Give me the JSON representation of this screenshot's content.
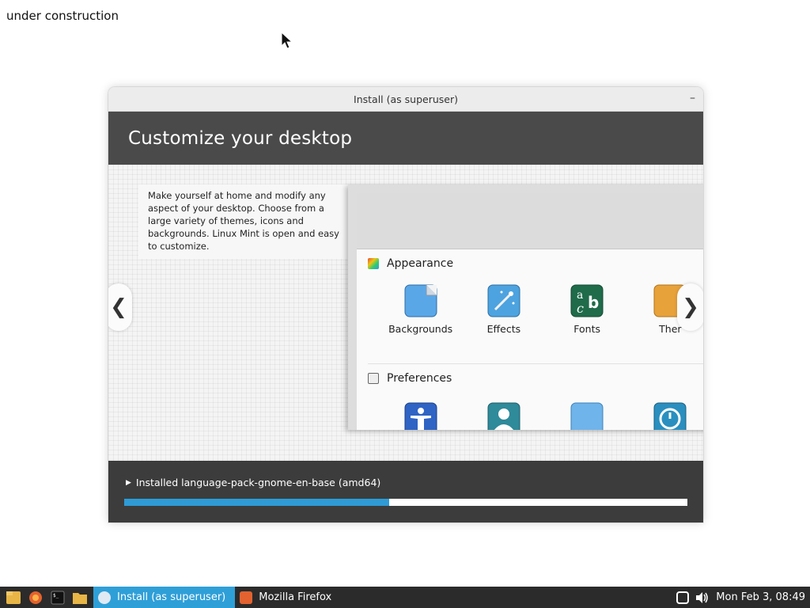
{
  "desktop": {
    "text": "under construction"
  },
  "window": {
    "title": "Install (as superuser)",
    "minimize_glyph": "–"
  },
  "banner": {
    "title": "Customize your desktop"
  },
  "slide": {
    "description": "Make yourself at home and modify any aspect of your desktop. Choose from a large variety of themes, icons and backgrounds. Linux Mint is open and easy to customize.",
    "prev_glyph": "❮",
    "next_glyph": "❯",
    "sections": {
      "appearance": {
        "title": "Appearance",
        "items": [
          {
            "label": "Backgrounds",
            "icon": "backgrounds-icon"
          },
          {
            "label": "Effects",
            "icon": "effects-icon"
          },
          {
            "label": "Fonts",
            "icon": "fonts-icon"
          },
          {
            "label": "Ther",
            "icon": "themes-icon"
          }
        ]
      },
      "preferences": {
        "title": "Preferences",
        "items": [
          {
            "icon": "accessibility-icon"
          },
          {
            "icon": "account-details-icon"
          },
          {
            "icon": "blank-app-icon"
          },
          {
            "icon": "date-time-icon"
          }
        ]
      }
    }
  },
  "progress": {
    "status": "Installed language-pack-gnome-en-base (amd64)",
    "fraction": 0.47
  },
  "taskbar": {
    "tasks": [
      {
        "label": "Install (as superuser)",
        "active": true
      },
      {
        "label": "Mozilla Firefox",
        "active": false
      }
    ],
    "clock": "Mon Feb  3, 08:49"
  },
  "colors": {
    "accent": "#2f9fd8",
    "progress_fill": "#2e9bd6",
    "banner_bg": "#4a4a4a",
    "taskbar_bg": "#2b2b2b"
  }
}
